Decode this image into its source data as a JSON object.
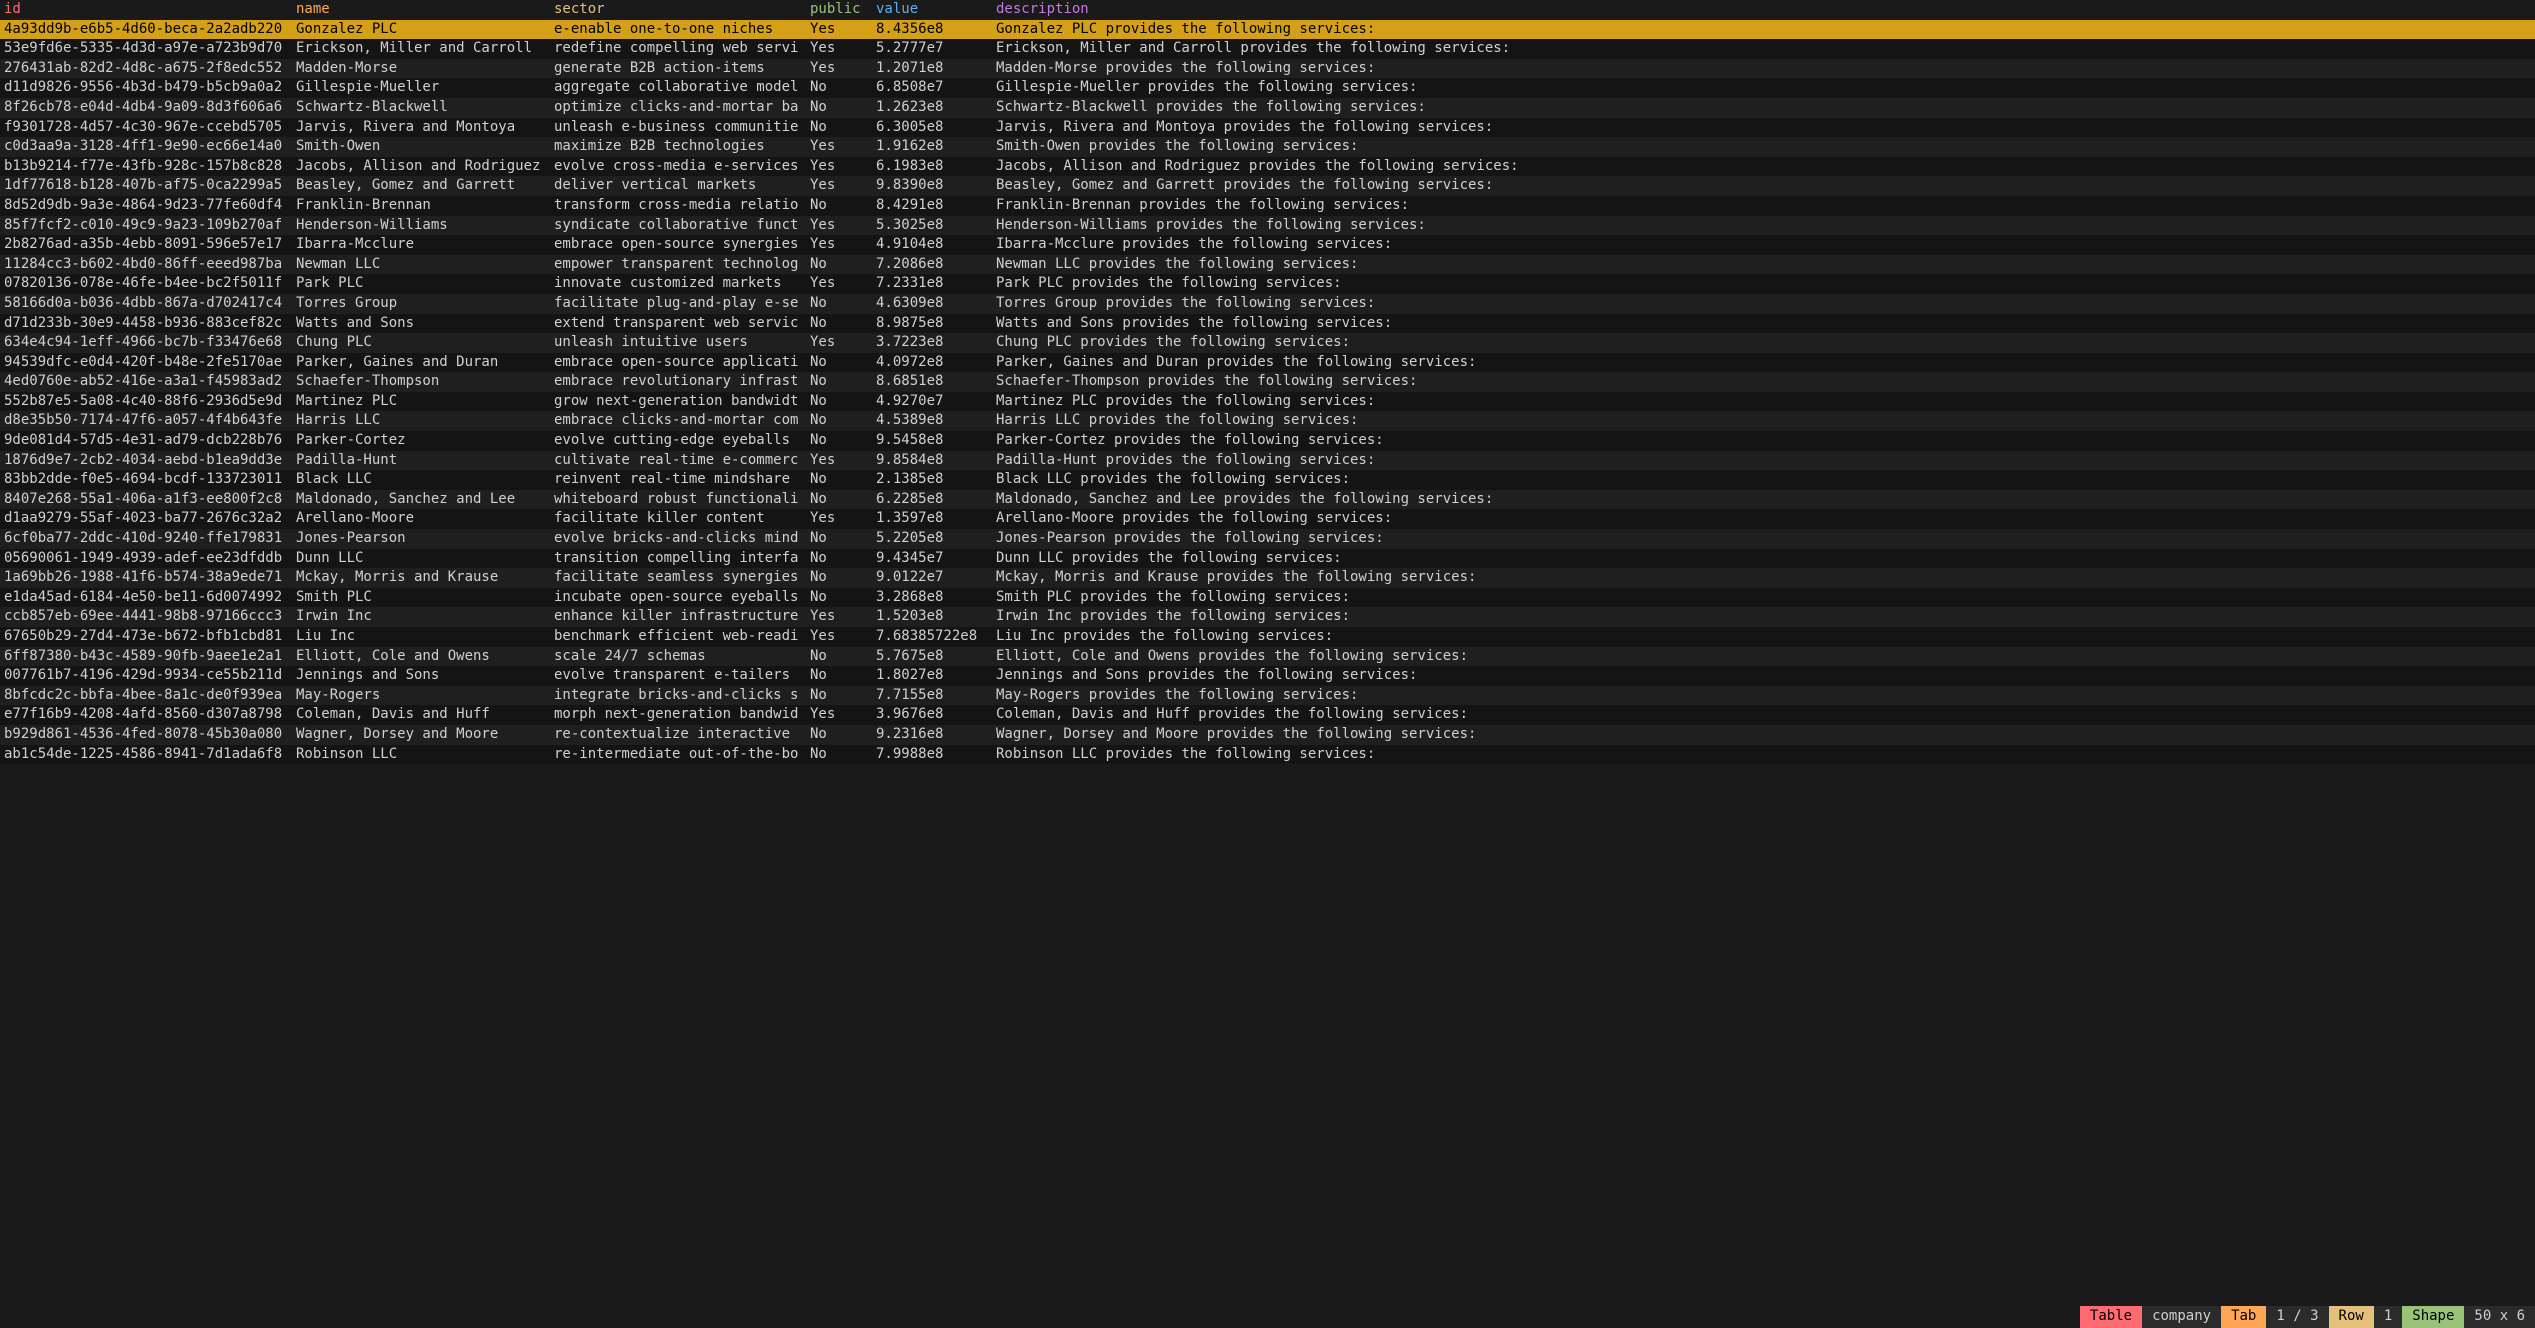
{
  "columns": [
    {
      "key": "id",
      "label": "id"
    },
    {
      "key": "name",
      "label": "name"
    },
    {
      "key": "sector",
      "label": "sector"
    },
    {
      "key": "public",
      "label": "public"
    },
    {
      "key": "value",
      "label": "value"
    },
    {
      "key": "description",
      "label": "description"
    }
  ],
  "selected_row_index": 0,
  "rows": [
    {
      "id": "4a93dd9b-e6b5-4d60-beca-2a2adb220",
      "name": "Gonzalez PLC",
      "sector": "e-enable one-to-one niches",
      "public": "Yes",
      "value": "8.4356e8",
      "description": "Gonzalez PLC provides the following services:"
    },
    {
      "id": "53e9fd6e-5335-4d3d-a97e-a723b9d70",
      "name": "Erickson, Miller and Carroll",
      "sector": "redefine compelling web servi",
      "public": "Yes",
      "value": "5.2777e7",
      "description": "Erickson, Miller and Carroll provides the following services:"
    },
    {
      "id": "276431ab-82d2-4d8c-a675-2f8edc552",
      "name": "Madden-Morse",
      "sector": "generate B2B action-items",
      "public": "Yes",
      "value": "1.2071e8",
      "description": "Madden-Morse provides the following services:"
    },
    {
      "id": "d11d9826-9556-4b3d-b479-b5cb9a0a2",
      "name": "Gillespie-Mueller",
      "sector": "aggregate collaborative model",
      "public": "No",
      "value": "6.8508e7",
      "description": "Gillespie-Mueller provides the following services:"
    },
    {
      "id": "8f26cb78-e04d-4db4-9a09-8d3f606a6",
      "name": "Schwartz-Blackwell",
      "sector": "optimize clicks-and-mortar ba",
      "public": "No",
      "value": "1.2623e8",
      "description": "Schwartz-Blackwell provides the following services:"
    },
    {
      "id": "f9301728-4d57-4c30-967e-ccebd5705",
      "name": "Jarvis, Rivera and Montoya",
      "sector": "unleash e-business communitie",
      "public": "No",
      "value": "6.3005e8",
      "description": "Jarvis, Rivera and Montoya provides the following services:"
    },
    {
      "id": "c0d3aa9a-3128-4ff1-9e90-ec66e14a0",
      "name": "Smith-Owen",
      "sector": "maximize B2B technologies",
      "public": "Yes",
      "value": "1.9162e8",
      "description": "Smith-Owen provides the following services:"
    },
    {
      "id": "b13b9214-f77e-43fb-928c-157b8c828",
      "name": "Jacobs, Allison and Rodriguez",
      "sector": "evolve cross-media e-services",
      "public": "Yes",
      "value": "6.1983e8",
      "description": "Jacobs, Allison and Rodriguez provides the following services:"
    },
    {
      "id": "1df77618-b128-407b-af75-0ca2299a5",
      "name": "Beasley, Gomez and Garrett",
      "sector": "deliver vertical markets",
      "public": "Yes",
      "value": "9.8390e8",
      "description": "Beasley, Gomez and Garrett provides the following services:"
    },
    {
      "id": "8d52d9db-9a3e-4864-9d23-77fe60df4",
      "name": "Franklin-Brennan",
      "sector": "transform cross-media relatio",
      "public": "No",
      "value": "8.4291e8",
      "description": "Franklin-Brennan provides the following services:"
    },
    {
      "id": "85f7fcf2-c010-49c9-9a23-109b270af",
      "name": "Henderson-Williams",
      "sector": "syndicate collaborative funct",
      "public": "Yes",
      "value": "5.3025e8",
      "description": "Henderson-Williams provides the following services:"
    },
    {
      "id": "2b8276ad-a35b-4ebb-8091-596e57e17",
      "name": "Ibarra-Mcclure",
      "sector": "embrace open-source synergies",
      "public": "Yes",
      "value": "4.9104e8",
      "description": "Ibarra-Mcclure provides the following services:"
    },
    {
      "id": "11284cc3-b602-4bd0-86ff-eeed987ba",
      "name": "Newman LLC",
      "sector": "empower transparent technolog",
      "public": "No",
      "value": "7.2086e8",
      "description": "Newman LLC provides the following services:"
    },
    {
      "id": "07820136-078e-46fe-b4ee-bc2f5011f",
      "name": "Park PLC",
      "sector": "innovate customized markets",
      "public": "Yes",
      "value": "7.2331e8",
      "description": "Park PLC provides the following services:"
    },
    {
      "id": "58166d0a-b036-4dbb-867a-d702417c4",
      "name": "Torres Group",
      "sector": "facilitate plug-and-play e-se",
      "public": "No",
      "value": "4.6309e8",
      "description": "Torres Group provides the following services:"
    },
    {
      "id": "d71d233b-30e9-4458-b936-883cef82c",
      "name": "Watts and Sons",
      "sector": "extend transparent web servic",
      "public": "No",
      "value": "8.9875e8",
      "description": "Watts and Sons provides the following services:"
    },
    {
      "id": "634e4c94-1eff-4966-bc7b-f33476e68",
      "name": "Chung PLC",
      "sector": "unleash intuitive users",
      "public": "Yes",
      "value": "3.7223e8",
      "description": "Chung PLC provides the following services:"
    },
    {
      "id": "94539dfc-e0d4-420f-b48e-2fe5170ae",
      "name": "Parker, Gaines and Duran",
      "sector": "embrace open-source applicati",
      "public": "No",
      "value": "4.0972e8",
      "description": "Parker, Gaines and Duran provides the following services:"
    },
    {
      "id": "4ed0760e-ab52-416e-a3a1-f45983ad2",
      "name": "Schaefer-Thompson",
      "sector": "embrace revolutionary infrast",
      "public": "No",
      "value": "8.6851e8",
      "description": "Schaefer-Thompson provides the following services:"
    },
    {
      "id": "552b87e5-5a08-4c40-88f6-2936d5e9d",
      "name": "Martinez PLC",
      "sector": "grow next-generation bandwidt",
      "public": "No",
      "value": "4.9270e7",
      "description": "Martinez PLC provides the following services:"
    },
    {
      "id": "d8e35b50-7174-47f6-a057-4f4b643fe",
      "name": "Harris LLC",
      "sector": "embrace clicks-and-mortar com",
      "public": "No",
      "value": "4.5389e8",
      "description": "Harris LLC provides the following services:"
    },
    {
      "id": "9de081d4-57d5-4e31-ad79-dcb228b76",
      "name": "Parker-Cortez",
      "sector": "evolve cutting-edge eyeballs",
      "public": "No",
      "value": "9.5458e8",
      "description": "Parker-Cortez provides the following services:"
    },
    {
      "id": "1876d9e7-2cb2-4034-aebd-b1ea9dd3e",
      "name": "Padilla-Hunt",
      "sector": "cultivate real-time e-commerc",
      "public": "Yes",
      "value": "9.8584e8",
      "description": "Padilla-Hunt provides the following services:"
    },
    {
      "id": "83bb2dde-f0e5-4694-bcdf-133723011",
      "name": "Black LLC",
      "sector": "reinvent real-time mindshare",
      "public": "No",
      "value": "2.1385e8",
      "description": "Black LLC provides the following services:"
    },
    {
      "id": "8407e268-55a1-406a-a1f3-ee800f2c8",
      "name": "Maldonado, Sanchez and Lee",
      "sector": "whiteboard robust functionali",
      "public": "No",
      "value": "6.2285e8",
      "description": "Maldonado, Sanchez and Lee provides the following services:"
    },
    {
      "id": "d1aa9279-55af-4023-ba77-2676c32a2",
      "name": "Arellano-Moore",
      "sector": "facilitate killer content",
      "public": "Yes",
      "value": "1.3597e8",
      "description": "Arellano-Moore provides the following services:"
    },
    {
      "id": "6cf0ba77-2ddc-410d-9240-ffe179831",
      "name": "Jones-Pearson",
      "sector": "evolve bricks-and-clicks mind",
      "public": "No",
      "value": "5.2205e8",
      "description": "Jones-Pearson provides the following services:"
    },
    {
      "id": "05690061-1949-4939-adef-ee23dfddb",
      "name": "Dunn LLC",
      "sector": "transition compelling interfa",
      "public": "No",
      "value": "9.4345e7",
      "description": "Dunn LLC provides the following services:"
    },
    {
      "id": "1a69bb26-1988-41f6-b574-38a9ede71",
      "name": "Mckay, Morris and Krause",
      "sector": "facilitate seamless synergies",
      "public": "No",
      "value": "9.0122e7",
      "description": "Mckay, Morris and Krause provides the following services:"
    },
    {
      "id": "e1da45ad-6184-4e50-be11-6d0074992",
      "name": "Smith PLC",
      "sector": "incubate open-source eyeballs",
      "public": "No",
      "value": "3.2868e8",
      "description": "Smith PLC provides the following services:"
    },
    {
      "id": "ccb857eb-69ee-4441-98b8-97166ccc3",
      "name": "Irwin Inc",
      "sector": "enhance killer infrastructure",
      "public": "Yes",
      "value": "1.5203e8",
      "description": "Irwin Inc provides the following services:"
    },
    {
      "id": "67650b29-27d4-473e-b672-bfb1cbd81",
      "name": "Liu Inc",
      "sector": "benchmark efficient web-readi",
      "public": "Yes",
      "value": "7.68385722e8",
      "description": "Liu Inc provides the following services:"
    },
    {
      "id": "6ff87380-b43c-4589-90fb-9aee1e2a1",
      "name": "Elliott, Cole and Owens",
      "sector": "scale 24/7 schemas",
      "public": "No",
      "value": "5.7675e8",
      "description": "Elliott, Cole and Owens provides the following services:"
    },
    {
      "id": "007761b7-4196-429d-9934-ce55b211d",
      "name": "Jennings and Sons",
      "sector": "evolve transparent e-tailers",
      "public": "No",
      "value": "1.8027e8",
      "description": "Jennings and Sons provides the following services:"
    },
    {
      "id": "8bfcdc2c-bbfa-4bee-8a1c-de0f939ea",
      "name": "May-Rogers",
      "sector": "integrate bricks-and-clicks s",
      "public": "No",
      "value": "7.7155e8",
      "description": "May-Rogers provides the following services:"
    },
    {
      "id": "e77f16b9-4208-4afd-8560-d307a8798",
      "name": "Coleman, Davis and Huff",
      "sector": "morph next-generation bandwid",
      "public": "Yes",
      "value": "3.9676e8",
      "description": "Coleman, Davis and Huff provides the following services:"
    },
    {
      "id": "b929d861-4536-4fed-8078-45b30a080",
      "name": "Wagner, Dorsey and Moore",
      "sector": "re-contextualize interactive",
      "public": "No",
      "value": "9.2316e8",
      "description": "Wagner, Dorsey and Moore provides the following services:"
    },
    {
      "id": "ab1c54de-1225-4586-8941-7d1ada6f8",
      "name": "Robinson LLC",
      "sector": "re-intermediate out-of-the-bo",
      "public": "No",
      "value": "7.9988e8",
      "description": "Robinson LLC provides the following services:"
    }
  ],
  "status": {
    "table_label": "Table",
    "table_value": "company",
    "tab_label": "Tab",
    "tab_value": "1 / 3",
    "row_label": "Row",
    "row_value": "1",
    "shape_label": "Shape",
    "shape_value": "50 x 6"
  }
}
